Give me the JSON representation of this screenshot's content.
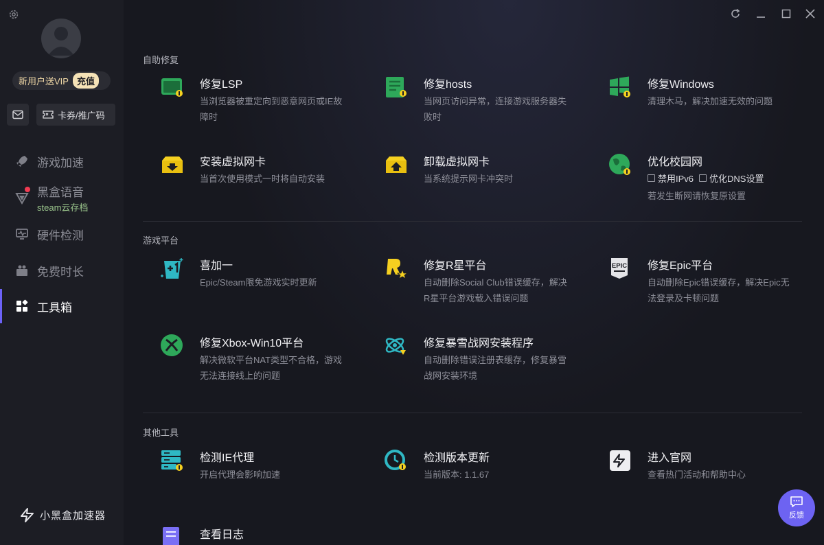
{
  "sidebar": {
    "vip_text": "新用户送VIP",
    "charge_label": "充值",
    "coupon_label": "卡券/推广码",
    "nav": [
      {
        "label": "游戏加速",
        "icon": "rocket-icon"
      },
      {
        "label": "黑盒语音",
        "sub": "steam云存档",
        "icon": "voice-icon"
      },
      {
        "label": "硬件检测",
        "icon": "monitor-icon"
      },
      {
        "label": "免费时长",
        "icon": "gift-icon"
      },
      {
        "label": "工具箱",
        "icon": "grid-icon"
      }
    ],
    "brand": "小黑盒加速器"
  },
  "sections": {
    "self_repair": "自助修复",
    "game_platform": "游戏平台",
    "other_tools": "其他工具"
  },
  "tools": {
    "lsp": {
      "name": "修复LSP",
      "desc": "当浏览器被重定向到恶意网页或IE故障时",
      "icon": "lsp-repair-icon"
    },
    "hosts": {
      "name": "修复hosts",
      "desc": "当网页访问异常，连接游戏服务器失败时",
      "icon": "hosts-repair-icon"
    },
    "windows": {
      "name": "修复Windows",
      "desc": "清理木马，解决加速无效的问题",
      "icon": "windows-repair-icon"
    },
    "install_nic": {
      "name": "安装虚拟网卡",
      "desc": "当首次使用模式一时将自动安装",
      "icon": "install-nic-icon"
    },
    "uninstall_nic": {
      "name": "卸载虚拟网卡",
      "desc": "当系统提示网卡冲突时",
      "icon": "uninstall-nic-icon"
    },
    "campus": {
      "name": "优化校园网",
      "opt1": "禁用IPv6",
      "opt2": "优化DNS设置",
      "desc": "若发生断网请恢复原设置",
      "icon": "globe-icon"
    },
    "xijiayi": {
      "name": "喜加一",
      "desc": "Epic/Steam限免游戏实时更新",
      "icon": "plus-one-icon"
    },
    "rockstar": {
      "name": "修复R星平台",
      "desc": "自动删除Social Club错误缓存，解决R星平台游戏载入错误问题",
      "icon": "rockstar-icon"
    },
    "epic": {
      "name": "修复Epic平台",
      "desc": "自动删除Epic错误缓存，解决Epic无法登录及卡顿问题",
      "icon": "epic-icon"
    },
    "xbox": {
      "name": "修复Xbox-Win10平台",
      "desc": "解决微软平台NAT类型不合格，游戏无法连接线上的问题",
      "icon": "xbox-icon"
    },
    "battlenet": {
      "name": "修复暴雪战网安装程序",
      "desc": "自动删除错误注册表缓存，修复暴雪战网安装环境",
      "icon": "battlenet-icon"
    },
    "ie_proxy": {
      "name": "检测IE代理",
      "desc": "开启代理会影响加速",
      "icon": "server-icon"
    },
    "version": {
      "name": "检测版本更新",
      "desc": "当前版本: 1.1.67",
      "icon": "update-icon"
    },
    "website": {
      "name": "进入官网",
      "desc": "查看热门活动和帮助中心",
      "icon": "website-icon"
    },
    "log": {
      "name": "查看日志",
      "icon": "log-icon"
    }
  },
  "feedback_label": "反馈",
  "colors": {
    "accent": "#6c62f7",
    "icon_green": "#3ec96f",
    "icon_yellow": "#f5d020",
    "icon_teal": "#2fb8c4"
  }
}
